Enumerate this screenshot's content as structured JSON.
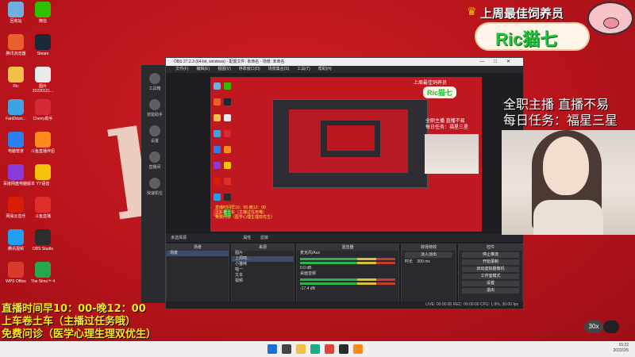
{
  "desktop": {
    "icons": [
      {
        "label": "回收站",
        "color": "#6db0e0"
      },
      {
        "label": "微信",
        "color": "#2dc100"
      },
      {
        "label": "腾讯浏览器",
        "color": "#e8612c"
      },
      {
        "label": "Steam",
        "color": "#1b2838"
      },
      {
        "label": "Ric",
        "color": "#f4c04a"
      },
      {
        "label": "图片\n20220121...",
        "color": "#e9e9e9"
      },
      {
        "label": "FanDown...",
        "color": "#3ea3e4"
      },
      {
        "label": "Cherry助手",
        "color": "#d62a36"
      },
      {
        "label": "电脑管家",
        "color": "#2c7df0"
      },
      {
        "label": "斗鱼直播伴侣",
        "color": "#ff8a1c"
      },
      {
        "label": "百度网盘电脑版本",
        "color": "#8a3ad8"
      },
      {
        "label": "YY语音",
        "color": "#f4c20d"
      },
      {
        "label": "网易云音乐",
        "color": "#d81e06"
      },
      {
        "label": "斗鱼直播",
        "color": "#e22d2d"
      },
      {
        "label": "腾讯视频",
        "color": "#1fa1f3"
      },
      {
        "label": "OBS Studio",
        "color": "#2c2c2c"
      },
      {
        "label": "WPS Office",
        "color": "#d93a2b"
      },
      {
        "label": "The Sims™ 4",
        "color": "#26a84a"
      }
    ]
  },
  "banner": {
    "title": "上周最佳饲养员",
    "name": "Ric猫七"
  },
  "obs": {
    "window_title": "OBS 27.2.3 (64-bit, windows) - 配置文件: 未命名 - 场景: 未命名",
    "menu": [
      "文件(F)",
      "编辑(E)",
      "视图(V)",
      "停靠窗口(D)",
      "场景集合(S)",
      "工具(T)",
      "帮助(H)"
    ],
    "left_panel": [
      "工具箱",
      "技能助手",
      "设置",
      "直播间",
      "快速机位"
    ],
    "controls_label": "未选择源",
    "props_label": "属性",
    "filters_label": "滤镜",
    "docks": {
      "scenes": {
        "title": "场景",
        "items": [
          "场景"
        ]
      },
      "sources": {
        "title": "来源",
        "items": [
          "图片",
          "上周吧...",
          "小猫咪",
          "唱一",
          "文本",
          "视频"
        ]
      },
      "mixer": {
        "title": "混音器",
        "tracks": [
          {
            "name": "麦克风/Aux",
            "db": "0.0 dB"
          },
          {
            "name": "桌面音频",
            "db": "-17.4 dB"
          }
        ]
      },
      "transitions": {
        "title": "转场特效",
        "type": "淡入淡出",
        "duration_label": "时长",
        "duration": "300 ms"
      },
      "controls": {
        "title": "控件",
        "buttons": [
          "停止推流",
          "开始录制",
          "启动虚拟摄像机",
          "工作室模式",
          "设置",
          "退出"
        ]
      }
    },
    "status": "LIVE: 00:00:00   REC: 00:00:00   CPU: 1.9%, 30.00 fps",
    "preview": {
      "title": "上周最佳饲养员",
      "name": "Ric猫七",
      "side_text": "全职主播 直播不易\n每日任务：福星三星",
      "bottom_text": "直播时间早10：00-晚12：00\n上车卷土车（主播过任务哦）\n免费问诊（医学心理生理双优生）"
    }
  },
  "webcam": {
    "line1": "全职主播 直播不易",
    "line2": "每日任务：福星三星"
  },
  "bottom_text": {
    "line1": "直播时间早10：00-晚12：00",
    "line2": "上车卷土车（主播过任务哦）",
    "line3": "免费问诊（医学心理生理双优生）"
  },
  "speed_badge": "30x",
  "taskbar": {
    "time": "15:22",
    "date": "2022/2/5",
    "icons": [
      {
        "name": "windows-start-icon",
        "color": "#1a6fd8"
      },
      {
        "name": "search-icon",
        "color": "#444444"
      },
      {
        "name": "file-explorer-icon",
        "color": "#f4c04a"
      },
      {
        "name": "edge-icon",
        "color": "#1faa8a"
      },
      {
        "name": "chrome-icon",
        "color": "#db4437"
      },
      {
        "name": "obs-icon",
        "color": "#2c2c2c"
      },
      {
        "name": "douyu-icon",
        "color": "#ff8a1c"
      }
    ]
  }
}
